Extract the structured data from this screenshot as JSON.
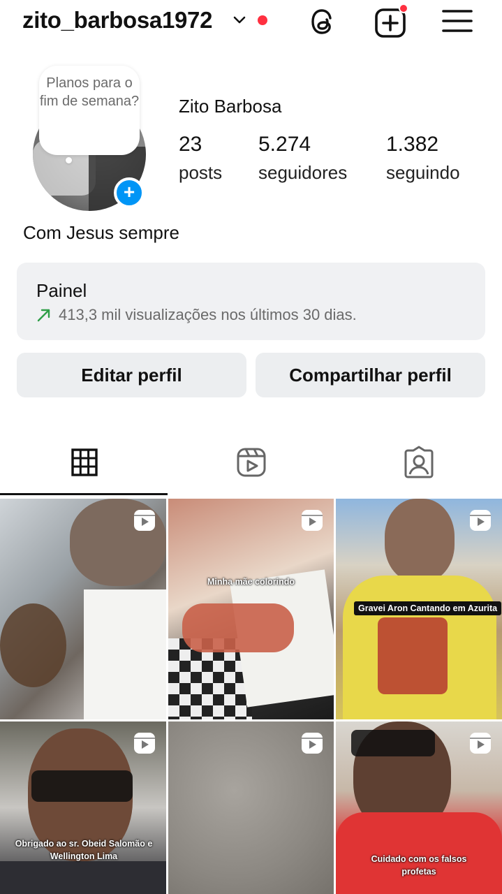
{
  "header": {
    "username": "zito_barbosa1972",
    "icons": [
      "chevron-down-icon",
      "threads-icon",
      "add-content-icon",
      "menu-icon"
    ]
  },
  "profile": {
    "note": "Planos para o fim de semana?",
    "display_name": "Zito Barbosa",
    "stats": [
      {
        "value": "23",
        "label": "posts"
      },
      {
        "value": "5.274",
        "label": "seguidores"
      },
      {
        "value": "1.382",
        "label": "seguindo"
      }
    ],
    "bio": "Com Jesus sempre"
  },
  "dashboard": {
    "title": "Painel",
    "subtitle": "413,3 mil visualizações nos últimos 30 dias."
  },
  "buttons": {
    "edit": "Editar perfil",
    "share": "Compartilhar perfil"
  },
  "tabs": [
    "grid-tab",
    "reels-tab",
    "tagged-tab"
  ],
  "posts": [
    {
      "caption": ""
    },
    {
      "caption": "Minha mãe colorindo"
    },
    {
      "caption": "Gravei Aron Cantando em Azurita"
    },
    {
      "caption": "Obrigado ao sr. Obeid Salomão e Wellington Lima"
    },
    {
      "caption": ""
    },
    {
      "caption": "Cuidado com os falsos profetas"
    }
  ],
  "colors": {
    "accent_blue": "#0095f6",
    "notification_red": "#ff3040",
    "trend_green": "#2e9e47",
    "panel_bg": "#f0f1f3"
  }
}
